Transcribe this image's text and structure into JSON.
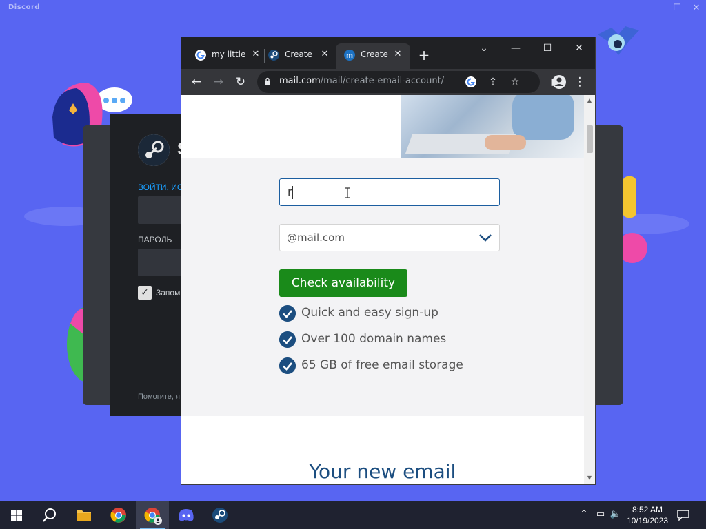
{
  "discord": {
    "logo_text": "Discord",
    "window_controls": {
      "minimize": "—",
      "maximize": "☐",
      "close": "✕"
    }
  },
  "steam": {
    "login_label": "ВОЙТИ, ИС",
    "password_label": "ПАРОЛЬ",
    "remember_label": "Запом",
    "help_link": "Помогите, я",
    "logo_s": "S"
  },
  "chrome": {
    "tabs": [
      {
        "label": "my little",
        "favicon": "google-icon",
        "active": false
      },
      {
        "label": "Create",
        "favicon": "steam-icon",
        "active": false
      },
      {
        "label": "Create",
        "favicon": "mailcom-icon",
        "active": true
      }
    ],
    "new_tab_label": "+",
    "window_controls": {
      "dropdown": "⌄",
      "minimize": "—",
      "maximize": "☐",
      "close": "✕"
    },
    "url_host": "mail.com",
    "url_path": "/mail/create-email-account/"
  },
  "page": {
    "email_input_value": "r",
    "domain_select_value": "@mail.com",
    "check_button_label": "Check availability",
    "features": [
      "Quick and easy sign-up",
      "Over 100 domain names",
      "65 GB of free email storage"
    ],
    "section_heading": "Your new email"
  },
  "taskbar": {
    "apps": [
      "start-icon",
      "search-icon",
      "file-explorer-icon",
      "chrome-icon",
      "chrome-profile-icon",
      "discord-icon",
      "steam-icon"
    ],
    "clock_time": "8:52 AM",
    "clock_date": "10/19/2023"
  },
  "colors": {
    "discord_blurple": "#5865f2",
    "mailcom_blue": "#1c4e80",
    "check_green": "#1a8a1a"
  }
}
